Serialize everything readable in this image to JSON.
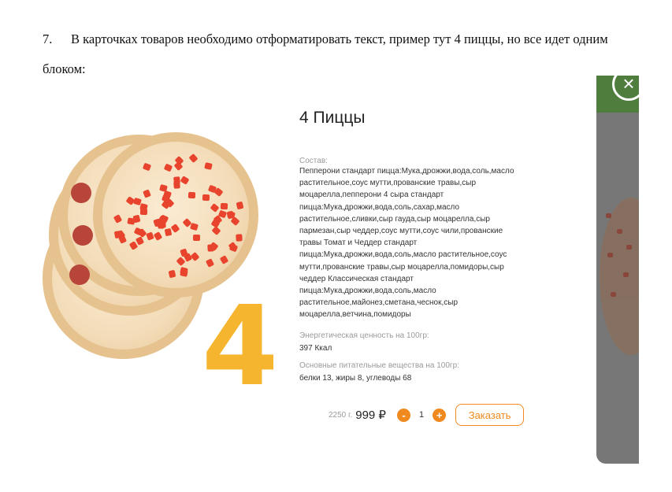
{
  "document": {
    "item_number": "7.",
    "item_text": "В карточках товаров необходимо отформатировать текст, пример тут 4 пиццы, но все идет одним блоком:"
  },
  "product": {
    "title": "4 Пиццы",
    "big_number": "4",
    "composition_label": "Состав:",
    "composition_text": "Пепперони стандарт пицца:Мука,дрожжи,вода,соль,масло растительное,соус мутти,прованские травы,сыр моцарелла,пепперони 4 сыра стандарт пицца:Мука,дрожжи,вода,соль,сахар,масло растительное,сливки,сыр гауда,сыр моцарелла,сыр пармезан,сыр чеддер,соус мутти,соус чили,прованские травы Томат и Чеддер стандарт пицца:Мука,дрожжи,вода,соль,масло растительное,соус мутти,прованские травы,сыр моцарелла,помидоры,сыр чеддер Классическая стандарт пицца:Мука,дрожжи,вода,соль,масло растительное,майонез,сметана,чеснок,сыр моцарелла,ветчина,помидоры",
    "energy_label": "Энергетическая ценность на 100гр:",
    "energy_value": "397 Ккал",
    "nutrients_label": "Основные питательные вещества на 100гр:",
    "nutrients_value": "белки 13, жиры 8, углеводы 68"
  },
  "order": {
    "weight": "2250 г.",
    "price": "999 ₽",
    "minus_label": "-",
    "quantity": "1",
    "plus_label": "+",
    "order_button": "Заказать"
  },
  "colors": {
    "accent": "#f08a1f",
    "big_number": "#f6b52e",
    "header_green": "#4e7d3d"
  },
  "icons": {
    "close": "close-icon"
  }
}
